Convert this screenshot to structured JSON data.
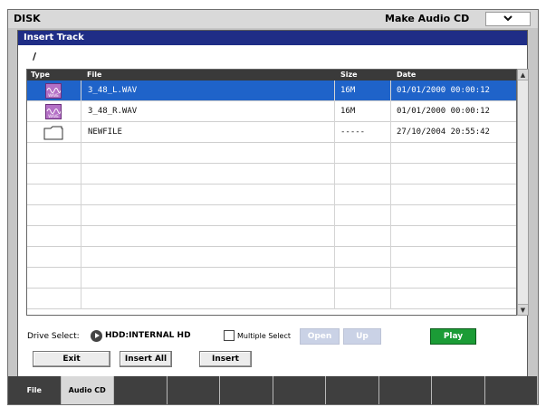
{
  "topbar": {
    "mode": "DISK",
    "page": "Make Audio CD",
    "menu_icon": "chevron-down-icon"
  },
  "dialog": {
    "title": "Insert Track",
    "path": "/"
  },
  "table": {
    "columns": [
      "Type",
      "File",
      "Size",
      "Date"
    ],
    "rows": [
      {
        "type": "wave-icon",
        "file": "3_48_L.WAV",
        "size": "16M",
        "date": "01/01/2000 00:00:12",
        "selected": true
      },
      {
        "type": "wave-icon",
        "file": "3_48_R.WAV",
        "size": "16M",
        "date": "01/01/2000 00:00:12",
        "selected": false
      },
      {
        "type": "folder-icon",
        "file": "NEWFILE",
        "size": "-----",
        "date": "27/10/2004 20:55:42",
        "selected": false
      }
    ],
    "empty_rows": 8
  },
  "controls": {
    "drive_select_label": "Drive Select:",
    "drive_value": "HDD:INTERNAL HD",
    "multiple_select_label": "Multiple Select",
    "multiple_select_checked": false,
    "open_label": "Open",
    "up_label": "Up",
    "play_label": "Play",
    "exit_label": "Exit",
    "insert_all_label": "Insert All",
    "insert_label": "Insert"
  },
  "tabs": [
    {
      "label": "File",
      "active": false
    },
    {
      "label": "Audio CD",
      "active": true
    },
    {
      "label": "",
      "active": false
    },
    {
      "label": "",
      "active": false
    },
    {
      "label": "",
      "active": false
    },
    {
      "label": "",
      "active": false
    },
    {
      "label": "",
      "active": false
    },
    {
      "label": "",
      "active": false
    },
    {
      "label": "",
      "active": false
    },
    {
      "label": "",
      "active": false
    }
  ],
  "colors": {
    "header": "#1f2d86",
    "selection": "#1f63c9",
    "play": "#1b9c36",
    "wave_icon": "#b470c6"
  }
}
